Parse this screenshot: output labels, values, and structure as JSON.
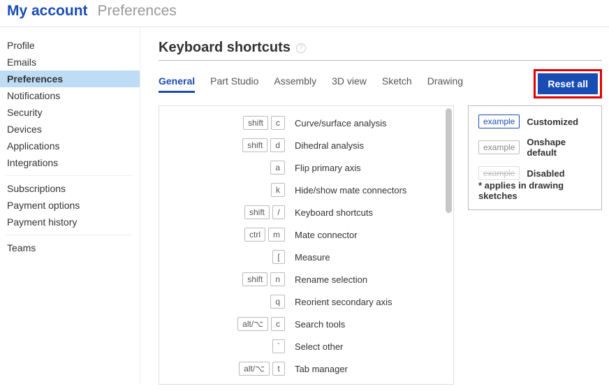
{
  "header": {
    "account": "My account",
    "page": "Preferences"
  },
  "sidebar": {
    "group1": [
      "Profile",
      "Emails",
      "Preferences",
      "Notifications",
      "Security",
      "Devices",
      "Applications",
      "Integrations"
    ],
    "group2": [
      "Subscriptions",
      "Payment options",
      "Payment history"
    ],
    "group3": [
      "Teams"
    ],
    "active": "Preferences"
  },
  "section": {
    "title": "Keyboard shortcuts"
  },
  "tabs": {
    "items": [
      "General",
      "Part Studio",
      "Assembly",
      "3D view",
      "Sketch",
      "Drawing"
    ],
    "active": "General"
  },
  "reset": {
    "label": "Reset all"
  },
  "shortcuts": [
    {
      "keys": [
        "shift",
        "c"
      ],
      "label": "Curve/surface analysis"
    },
    {
      "keys": [
        "shift",
        "d"
      ],
      "label": "Dihedral analysis"
    },
    {
      "keys": [
        "a"
      ],
      "label": "Flip primary axis"
    },
    {
      "keys": [
        "k"
      ],
      "label": "Hide/show mate connectors"
    },
    {
      "keys": [
        "shift",
        "/"
      ],
      "label": "Keyboard shortcuts"
    },
    {
      "keys": [
        "ctrl",
        "m"
      ],
      "label": "Mate connector"
    },
    {
      "keys": [
        "["
      ],
      "label": "Measure"
    },
    {
      "keys": [
        "shift",
        "n"
      ],
      "label": "Rename selection"
    },
    {
      "keys": [
        "q"
      ],
      "label": "Reorient secondary axis"
    },
    {
      "keys": [
        "alt/⌥",
        "c"
      ],
      "label": "Search tools"
    },
    {
      "keys": [
        "`"
      ],
      "label": "Select other"
    },
    {
      "keys": [
        "alt/⌥",
        "t"
      ],
      "label": "Tab manager"
    }
  ],
  "legend": {
    "items": [
      {
        "key": "example",
        "klass": "customized",
        "label": "Customized"
      },
      {
        "key": "example",
        "klass": "default",
        "label": "Onshape default"
      },
      {
        "key": "example",
        "klass": "disabled",
        "label": "Disabled"
      }
    ],
    "note": "* applies in drawing sketches"
  }
}
